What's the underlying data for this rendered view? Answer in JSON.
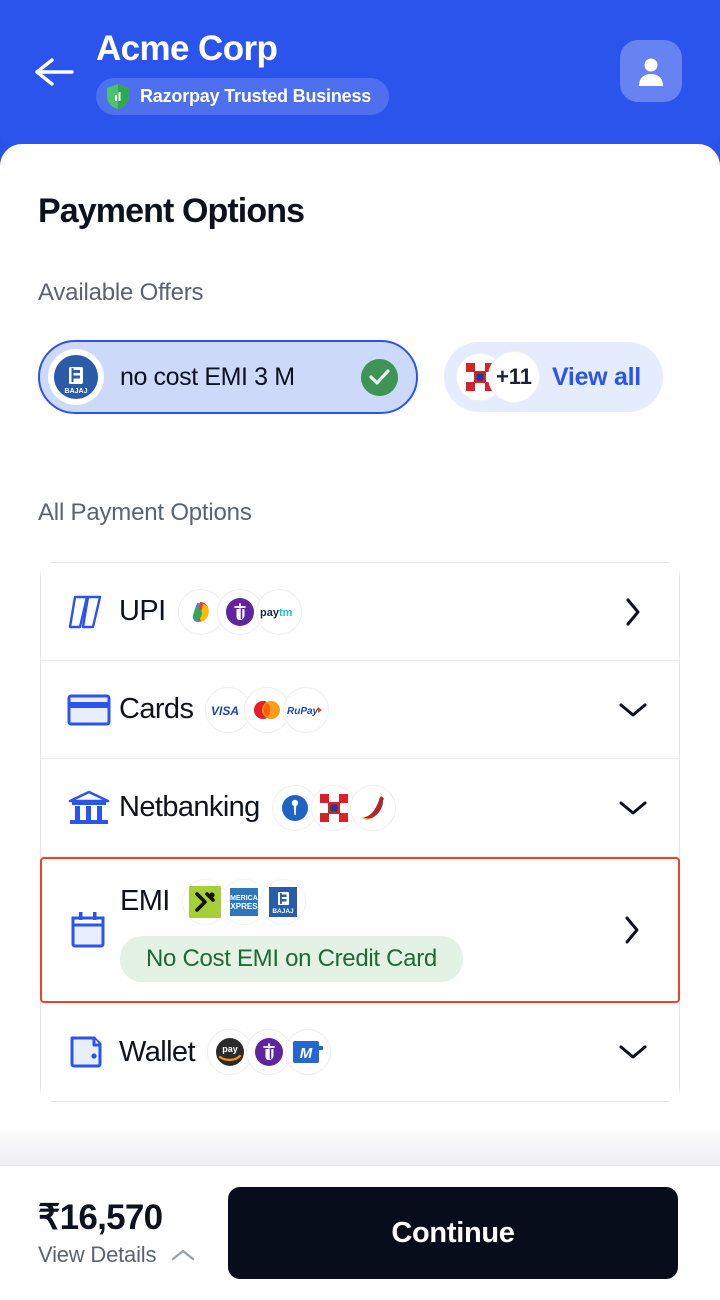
{
  "header": {
    "merchant_name": "Acme Corp",
    "trust_badge": "Razorpay Trusted Business",
    "back_icon": "arrow-left-icon",
    "avatar_icon": "user-avatar-icon",
    "bg_color": "#2b54ec"
  },
  "page": {
    "title": "Payment Options",
    "offers_label": "Available Offers",
    "all_options_label": "All Payment Options"
  },
  "offers": {
    "selected": {
      "logo": "bajaj-finserv-logo",
      "text": "no cost EMI 3 M",
      "selected_icon": "check-circle-icon",
      "accent": "#2b54ec",
      "fill": "#ccd9f8"
    },
    "view_all": {
      "logo": "hdfc-bank-logo",
      "count": "+11",
      "label": "View all",
      "link_color": "#2b54ec",
      "fill": "#e4ecfd"
    }
  },
  "methods": [
    {
      "name": "UPI",
      "icon": "upi-arrows-icon",
      "chevron": "chevron-right-icon",
      "brands": [
        "google-pay-logo",
        "phonepe-logo",
        "paytm-logo"
      ],
      "offer_tag": null,
      "highlighted": false
    },
    {
      "name": "Cards",
      "icon": "credit-card-icon",
      "chevron": "chevron-down-icon",
      "brands": [
        "visa-logo",
        "mastercard-logo",
        "rupay-logo"
      ],
      "offer_tag": null,
      "highlighted": false
    },
    {
      "name": "Netbanking",
      "icon": "bank-building-icon",
      "chevron": "chevron-down-icon",
      "brands": [
        "sbi-logo",
        "hdfc-logo",
        "icici-logo"
      ],
      "offer_tag": null,
      "highlighted": false
    },
    {
      "name": "EMI",
      "icon": "calendar-icon",
      "chevron": "chevron-right-icon",
      "brands": [
        "zest-money-logo",
        "amex-logo",
        "bajaj-logo"
      ],
      "offer_tag": "No Cost EMI on Credit Card",
      "highlighted": true,
      "highlight_color": "#e8442a"
    },
    {
      "name": "Wallet",
      "icon": "wallet-icon",
      "chevron": "chevron-down-icon",
      "brands": [
        "amazon-pay-logo",
        "phonepe-logo",
        "mobikwik-logo"
      ],
      "offer_tag": null,
      "highlighted": false
    }
  ],
  "footer": {
    "amount": "₹16,570",
    "details_label": "View Details",
    "details_icon": "chevron-up-icon",
    "continue_label": "Continue",
    "button_color": "#080d1c"
  }
}
